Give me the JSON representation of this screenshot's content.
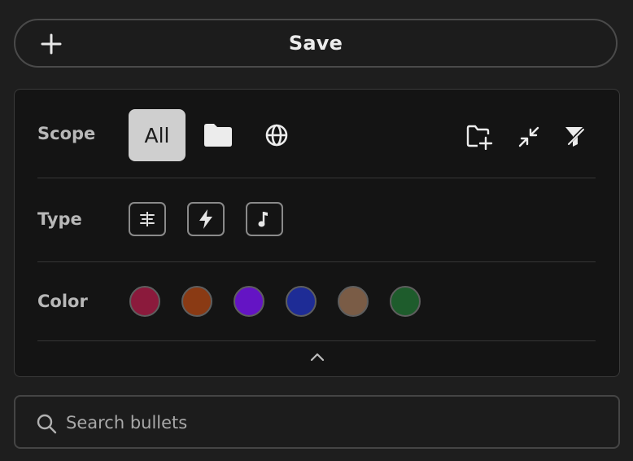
{
  "save": {
    "label": "Save",
    "icon": "plus-icon"
  },
  "filters": {
    "scope": {
      "label": "Scope",
      "all_label": "All",
      "icons": [
        "folder-icon",
        "globe-icon",
        "new-folder-icon",
        "collapse-arrows-icon",
        "filter-clear-icon"
      ]
    },
    "type": {
      "label": "Type",
      "icons": [
        "align-center-icon",
        "lightning-icon",
        "music-note-icon"
      ]
    },
    "color": {
      "label": "Color",
      "swatches": [
        "#8b1a3c",
        "#8a3a14",
        "#6414c4",
        "#1e2c96",
        "#7a5c46",
        "#1e5c2c"
      ]
    },
    "collapse_icon": "chevron-up-icon"
  },
  "search": {
    "placeholder": "Search bullets",
    "value": "",
    "icon": "search-icon"
  }
}
